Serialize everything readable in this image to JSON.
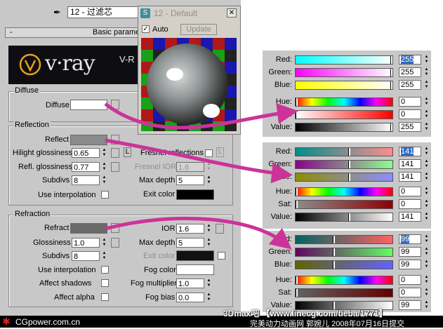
{
  "toolbar": {
    "material_name": "12 - 过滤芯"
  },
  "rollout": {
    "toggle": "-",
    "title": "Basic parameters"
  },
  "logo": {
    "brand": "v·ray",
    "right_text": "V-R"
  },
  "diffuse": {
    "group": "Diffuse",
    "label": "Diffuse",
    "color": "#ffffff"
  },
  "reflection": {
    "group": "Reflection",
    "reflect_label": "Reflect",
    "reflect_color": "#8a8a8a",
    "hilight_label": "Hilight glossiness",
    "hilight_value": "0.65",
    "l_button": "L",
    "fresnel_label": "Fresnel reflections",
    "fresnel_l": "L",
    "refl_gloss_label": "Refl. glossiness",
    "refl_gloss_value": "0.77",
    "fresnel_ior_label": "Fresnel IOR",
    "fresnel_ior_value": "1.6",
    "subdivs_label": "Subdivs",
    "subdivs_value": "8",
    "max_depth_label": "Max depth",
    "max_depth_value": "5",
    "use_interp_label": "Use interpolation",
    "exit_color_label": "Exit color",
    "exit_color": "#000000"
  },
  "refraction": {
    "group": "Refraction",
    "refract_label": "Refract",
    "refract_color": "#6a6a6a",
    "ior_label": "IOR",
    "ior_value": "1.6",
    "gloss_label": "Glossiness",
    "gloss_value": "1.0",
    "max_depth_label": "Max depth",
    "max_depth_value": "5",
    "subdivs_label": "Subdivs",
    "subdivs_value": "8",
    "exit_color_label": "Exit color",
    "exit_color": "#111111",
    "use_interp_label": "Use interpolation",
    "fog_color_label": "Fog color",
    "fog_color": "#ffffff",
    "affect_shadows_label": "Affect shadows",
    "fog_mult_label": "Fog multiplier",
    "fog_mult_value": "1.0",
    "affect_alpha_label": "Affect alpha",
    "fog_bias_label": "Fog bias",
    "fog_bias_value": "0.0"
  },
  "mat_window": {
    "title": "12 - Default",
    "auto_label": "Auto",
    "update_label": "Update"
  },
  "color_selectors": [
    {
      "rows": [
        {
          "label": "Red:",
          "value": "255",
          "selected": true
        },
        {
          "label": "Green:",
          "value": "255"
        },
        {
          "label": "Blue:",
          "value": "255"
        },
        {
          "label": "Hue:",
          "value": "0"
        },
        {
          "label": "Sat:",
          "value": "0"
        },
        {
          "label": "Value:",
          "value": "255"
        }
      ]
    },
    {
      "rows": [
        {
          "label": "Red:",
          "value": "141",
          "selected": true
        },
        {
          "label": "Green:",
          "value": "141"
        },
        {
          "label": "Blue:",
          "value": "141"
        },
        {
          "label": "Hue:",
          "value": "0"
        },
        {
          "label": "Sat:",
          "value": "0"
        },
        {
          "label": "Value:",
          "value": "141"
        }
      ]
    },
    {
      "rows": [
        {
          "label": "Red:",
          "value": "99",
          "selected": true
        },
        {
          "label": "Green:",
          "value": "99"
        },
        {
          "label": "Blue:",
          "value": "99"
        },
        {
          "label": "Hue:",
          "value": "0"
        },
        {
          "label": "Sat:",
          "value": "0"
        },
        {
          "label": "Value:",
          "value": "99"
        }
      ]
    }
  ],
  "watermark": {
    "site": "CGpower.com.cn",
    "forum": "3Dmax吧 【www.linecg.com/tieba/1771】",
    "credit": "完美动力动画网 郭婉儿 2008年07月16日提交"
  },
  "colors": {
    "arrow": "#cc3399",
    "panel_bg": "#c8c8c8",
    "selection": "#316ac5"
  }
}
